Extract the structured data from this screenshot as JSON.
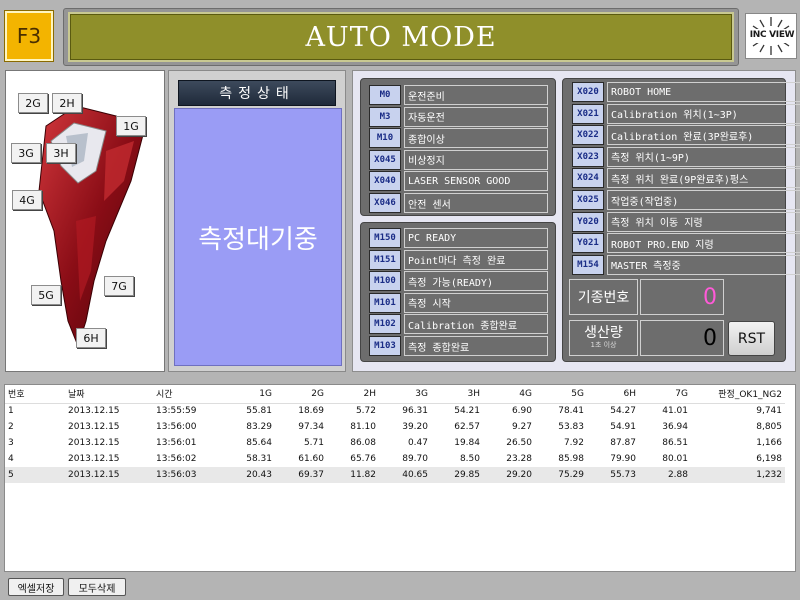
{
  "header": {
    "mode_key": "F3",
    "title": "AUTO MODE",
    "logo_text": "INC VIEW"
  },
  "product": {
    "tags": [
      "2G",
      "2H",
      "1G",
      "3G",
      "3H",
      "4G",
      "5G",
      "7G",
      "6H"
    ]
  },
  "status": {
    "heading": "측정상태",
    "value": "측정대기중"
  },
  "io_panel_1": [
    {
      "code": "M0",
      "label": "운전준비"
    },
    {
      "code": "M3",
      "label": "자동운전"
    },
    {
      "code": "M10",
      "label": "종합이상"
    },
    {
      "code": "X045",
      "label": "비상정지"
    },
    {
      "code": "X040",
      "label": "LASER SENSOR GOOD"
    },
    {
      "code": "X046",
      "label": "안전 센서"
    }
  ],
  "io_panel_2": [
    {
      "code": "M150",
      "label": "PC READY"
    },
    {
      "code": "M151",
      "label": "Point마다 측정 완료"
    },
    {
      "code": "M100",
      "label": "측정 가능(READY)"
    },
    {
      "code": "M101",
      "label": "측정 시작"
    },
    {
      "code": "M102",
      "label": "Calibration 종합완료"
    },
    {
      "code": "M103",
      "label": "측정 종합완료"
    }
  ],
  "io_panel_3": [
    {
      "code": "X020",
      "label": "ROBOT HOME"
    },
    {
      "code": "X021",
      "label": "Calibration 위치(1~3P)"
    },
    {
      "code": "X022",
      "label": "Calibration 완료(3P완료후)"
    },
    {
      "code": "X023",
      "label": "측정 위치(1~9P)"
    },
    {
      "code": "X024",
      "label": "측정 위치 완료(9P완료후)펑스"
    },
    {
      "code": "X025",
      "label": "작업중(작업중)"
    },
    {
      "code": "Y020",
      "label": "측정 위치 이동 지령"
    },
    {
      "code": "Y021",
      "label": "ROBOT PRO.END 지령"
    },
    {
      "code": "M154",
      "label": "MASTER 측정중"
    }
  ],
  "model": {
    "label": "기종번호",
    "value": "0"
  },
  "production": {
    "label": "생산량",
    "sublabel": "1초 이상",
    "value": "0",
    "reset_label": "RST"
  },
  "table": {
    "headers": [
      "번호",
      "날짜",
      "시간",
      "1G",
      "2G",
      "2H",
      "3G",
      "3H",
      "4G",
      "5G",
      "6H",
      "7G",
      "판정_OK1_NG2"
    ],
    "rows": [
      [
        "1",
        "2013.12.15",
        "13:55:59",
        "55.81",
        "18.69",
        "5.72",
        "96.31",
        "54.21",
        "6.90",
        "78.41",
        "54.27",
        "41.01",
        "9,741"
      ],
      [
        "2",
        "2013.12.15",
        "13:56:00",
        "83.29",
        "97.34",
        "81.10",
        "39.20",
        "62.57",
        "9.27",
        "53.83",
        "54.91",
        "36.94",
        "8,805"
      ],
      [
        "3",
        "2013.12.15",
        "13:56:01",
        "85.64",
        "5.71",
        "86.08",
        "0.47",
        "19.84",
        "26.50",
        "7.92",
        "87.87",
        "86.51",
        "1,166"
      ],
      [
        "4",
        "2013.12.15",
        "13:56:02",
        "58.31",
        "61.60",
        "65.76",
        "89.70",
        "8.50",
        "23.28",
        "85.98",
        "79.90",
        "80.01",
        "6,198"
      ],
      [
        "5",
        "2013.12.15",
        "13:56:03",
        "20.43",
        "69.37",
        "11.82",
        "40.65",
        "29.85",
        "29.20",
        "75.29",
        "55.73",
        "2.88",
        "1,232"
      ]
    ]
  },
  "footer": {
    "excel_save": "엑셀저장",
    "delete_all": "모두삭제"
  }
}
